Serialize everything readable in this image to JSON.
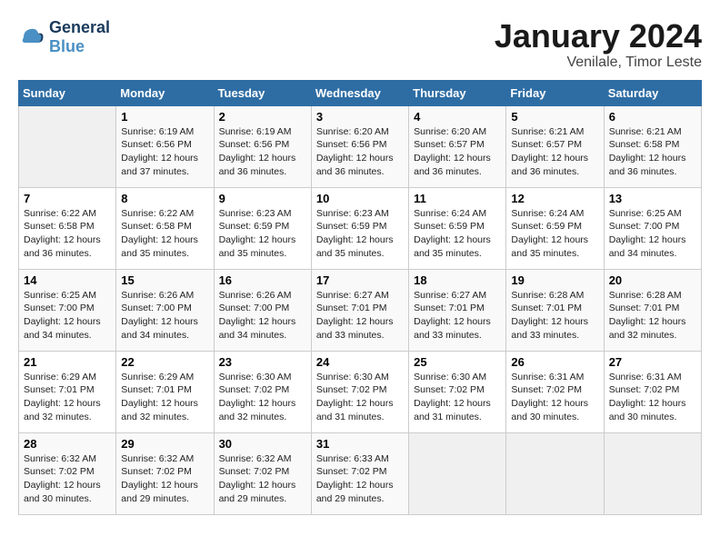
{
  "header": {
    "logo_line1": "General",
    "logo_line2": "Blue",
    "month": "January 2024",
    "location": "Venilale, Timor Leste"
  },
  "weekdays": [
    "Sunday",
    "Monday",
    "Tuesday",
    "Wednesday",
    "Thursday",
    "Friday",
    "Saturday"
  ],
  "weeks": [
    [
      {
        "day": "",
        "info": ""
      },
      {
        "day": "1",
        "info": "Sunrise: 6:19 AM\nSunset: 6:56 PM\nDaylight: 12 hours\nand 37 minutes."
      },
      {
        "day": "2",
        "info": "Sunrise: 6:19 AM\nSunset: 6:56 PM\nDaylight: 12 hours\nand 36 minutes."
      },
      {
        "day": "3",
        "info": "Sunrise: 6:20 AM\nSunset: 6:56 PM\nDaylight: 12 hours\nand 36 minutes."
      },
      {
        "day": "4",
        "info": "Sunrise: 6:20 AM\nSunset: 6:57 PM\nDaylight: 12 hours\nand 36 minutes."
      },
      {
        "day": "5",
        "info": "Sunrise: 6:21 AM\nSunset: 6:57 PM\nDaylight: 12 hours\nand 36 minutes."
      },
      {
        "day": "6",
        "info": "Sunrise: 6:21 AM\nSunset: 6:58 PM\nDaylight: 12 hours\nand 36 minutes."
      }
    ],
    [
      {
        "day": "7",
        "info": "Sunrise: 6:22 AM\nSunset: 6:58 PM\nDaylight: 12 hours\nand 36 minutes."
      },
      {
        "day": "8",
        "info": "Sunrise: 6:22 AM\nSunset: 6:58 PM\nDaylight: 12 hours\nand 35 minutes."
      },
      {
        "day": "9",
        "info": "Sunrise: 6:23 AM\nSunset: 6:59 PM\nDaylight: 12 hours\nand 35 minutes."
      },
      {
        "day": "10",
        "info": "Sunrise: 6:23 AM\nSunset: 6:59 PM\nDaylight: 12 hours\nand 35 minutes."
      },
      {
        "day": "11",
        "info": "Sunrise: 6:24 AM\nSunset: 6:59 PM\nDaylight: 12 hours\nand 35 minutes."
      },
      {
        "day": "12",
        "info": "Sunrise: 6:24 AM\nSunset: 6:59 PM\nDaylight: 12 hours\nand 35 minutes."
      },
      {
        "day": "13",
        "info": "Sunrise: 6:25 AM\nSunset: 7:00 PM\nDaylight: 12 hours\nand 34 minutes."
      }
    ],
    [
      {
        "day": "14",
        "info": "Sunrise: 6:25 AM\nSunset: 7:00 PM\nDaylight: 12 hours\nand 34 minutes."
      },
      {
        "day": "15",
        "info": "Sunrise: 6:26 AM\nSunset: 7:00 PM\nDaylight: 12 hours\nand 34 minutes."
      },
      {
        "day": "16",
        "info": "Sunrise: 6:26 AM\nSunset: 7:00 PM\nDaylight: 12 hours\nand 34 minutes."
      },
      {
        "day": "17",
        "info": "Sunrise: 6:27 AM\nSunset: 7:01 PM\nDaylight: 12 hours\nand 33 minutes."
      },
      {
        "day": "18",
        "info": "Sunrise: 6:27 AM\nSunset: 7:01 PM\nDaylight: 12 hours\nand 33 minutes."
      },
      {
        "day": "19",
        "info": "Sunrise: 6:28 AM\nSunset: 7:01 PM\nDaylight: 12 hours\nand 33 minutes."
      },
      {
        "day": "20",
        "info": "Sunrise: 6:28 AM\nSunset: 7:01 PM\nDaylight: 12 hours\nand 32 minutes."
      }
    ],
    [
      {
        "day": "21",
        "info": "Sunrise: 6:29 AM\nSunset: 7:01 PM\nDaylight: 12 hours\nand 32 minutes."
      },
      {
        "day": "22",
        "info": "Sunrise: 6:29 AM\nSunset: 7:01 PM\nDaylight: 12 hours\nand 32 minutes."
      },
      {
        "day": "23",
        "info": "Sunrise: 6:30 AM\nSunset: 7:02 PM\nDaylight: 12 hours\nand 32 minutes."
      },
      {
        "day": "24",
        "info": "Sunrise: 6:30 AM\nSunset: 7:02 PM\nDaylight: 12 hours\nand 31 minutes."
      },
      {
        "day": "25",
        "info": "Sunrise: 6:30 AM\nSunset: 7:02 PM\nDaylight: 12 hours\nand 31 minutes."
      },
      {
        "day": "26",
        "info": "Sunrise: 6:31 AM\nSunset: 7:02 PM\nDaylight: 12 hours\nand 30 minutes."
      },
      {
        "day": "27",
        "info": "Sunrise: 6:31 AM\nSunset: 7:02 PM\nDaylight: 12 hours\nand 30 minutes."
      }
    ],
    [
      {
        "day": "28",
        "info": "Sunrise: 6:32 AM\nSunset: 7:02 PM\nDaylight: 12 hours\nand 30 minutes."
      },
      {
        "day": "29",
        "info": "Sunrise: 6:32 AM\nSunset: 7:02 PM\nDaylight: 12 hours\nand 29 minutes."
      },
      {
        "day": "30",
        "info": "Sunrise: 6:32 AM\nSunset: 7:02 PM\nDaylight: 12 hours\nand 29 minutes."
      },
      {
        "day": "31",
        "info": "Sunrise: 6:33 AM\nSunset: 7:02 PM\nDaylight: 12 hours\nand 29 minutes."
      },
      {
        "day": "",
        "info": ""
      },
      {
        "day": "",
        "info": ""
      },
      {
        "day": "",
        "info": ""
      }
    ]
  ]
}
